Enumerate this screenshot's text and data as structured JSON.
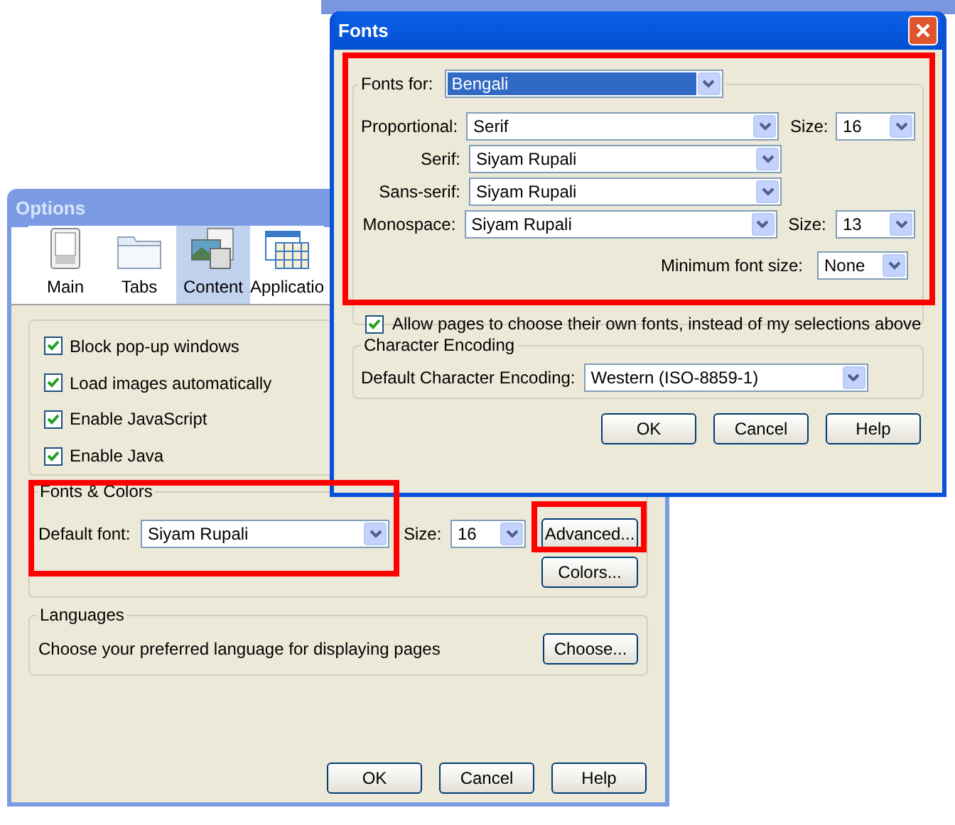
{
  "options_window": {
    "title": "Options",
    "toolbar": [
      {
        "label": "Main",
        "selected": false
      },
      {
        "label": "Tabs",
        "selected": false
      },
      {
        "label": "Content",
        "selected": true
      },
      {
        "label": "Applicatio",
        "selected": false
      }
    ],
    "checkboxes": [
      {
        "label": "Block pop-up windows",
        "checked": true
      },
      {
        "label": "Load images automatically",
        "checked": true
      },
      {
        "label": "Enable JavaScript",
        "checked": true
      },
      {
        "label": "Enable Java",
        "checked": true
      }
    ],
    "fonts_colors": {
      "legend": "Fonts & Colors",
      "default_font_label": "Default font:",
      "default_font": "Siyam Rupali",
      "size_label": "Size:",
      "size": "16",
      "buttons": [
        "Advanced...",
        "Colors..."
      ]
    },
    "languages": {
      "legend": "Languages",
      "text": "Choose your preferred language for displaying pages",
      "button": "Choose..."
    },
    "buttons": [
      "OK",
      "Cancel",
      "Help"
    ]
  },
  "fonts_window": {
    "title": "Fonts",
    "fonts_for_label": "Fonts for:",
    "fonts_for": {
      "value": "Bengali",
      "focused": true
    },
    "rows": [
      {
        "label": "Proportional:",
        "value": "Serif",
        "size_label": "Size:",
        "size": "16"
      },
      {
        "label": "Serif:",
        "value": "Siyam Rupali"
      },
      {
        "label": "Sans-serif:",
        "value": "Siyam Rupali"
      },
      {
        "label": "Monospace:",
        "value": "Siyam Rupali",
        "size_label": "Size:",
        "size": "13"
      }
    ],
    "min_size_label": "Minimum font size:",
    "min_size": "None",
    "allow_fonts": {
      "label": "Allow pages to choose their own fonts, instead of my selections above",
      "checked": true
    },
    "encoding": {
      "legend": "Character Encoding",
      "label": "Default Character Encoding:",
      "value": "Western (ISO-8859-1)"
    },
    "buttons": [
      "OK",
      "Cancel",
      "Help"
    ]
  }
}
